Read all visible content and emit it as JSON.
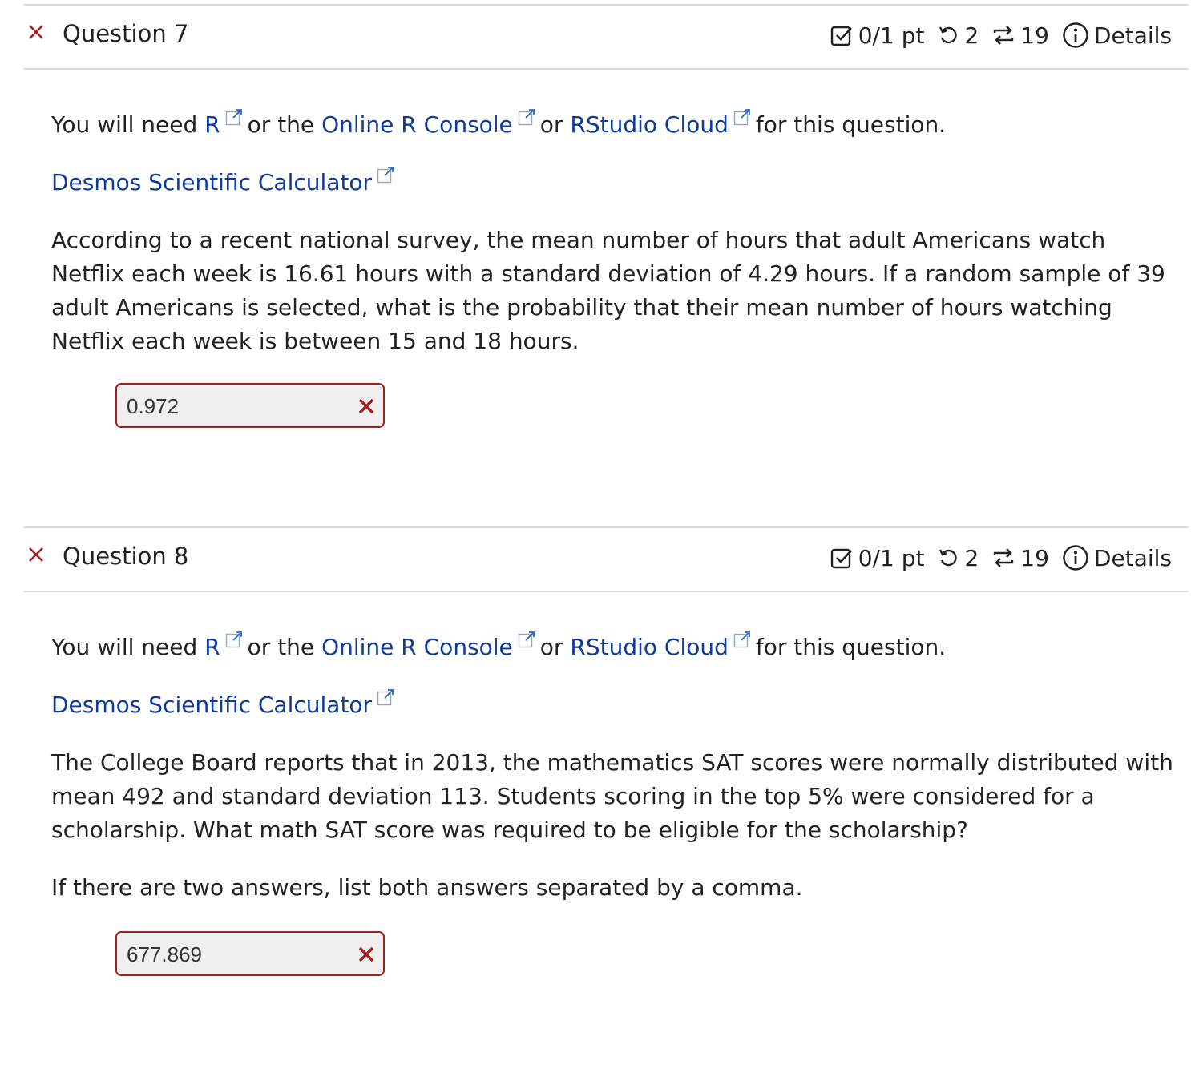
{
  "colors": {
    "link": "#0e3a9a",
    "incorrect": "#a31f1f",
    "answer_bg": "#efefef",
    "divider": "#d9d9d9"
  },
  "questions": [
    {
      "title": "Question 7",
      "status_icon": "close-icon",
      "score": "0/1 pt",
      "attempts": "2",
      "versions": "19",
      "details_label": "Details",
      "tools": {
        "prefix": "You will need",
        "r_link": "R",
        "or_the": "or the",
        "console_link": "Online R Console",
        "or": "or",
        "cloud_link": "RStudio Cloud",
        "suffix": "for this question."
      },
      "desmos_link": "Desmos Scientific Calculator",
      "stem": "According to a recent national survey, the mean number of hours that adult Americans watch Netflix each week is 16.61 hours with a standard deviation of 4.29 hours. If a random sample of 39 adult Americans is selected, what is the probability that their mean number of hours watching Netflix each week is between 15 and 18 hours.",
      "answer": "0.972"
    },
    {
      "title": "Question 8",
      "status_icon": "close-icon",
      "score": "0/1 pt",
      "attempts": "2",
      "versions": "19",
      "details_label": "Details",
      "tools": {
        "prefix": "You will need",
        "r_link": "R",
        "or_the": "or the",
        "console_link": "Online R Console",
        "or": "or",
        "cloud_link": "RStudio Cloud",
        "suffix": "for this question."
      },
      "desmos_link": "Desmos Scientific Calculator",
      "stem": "The College Board reports that in 2013, the mathematics SAT scores were normally distributed with mean 492 and standard deviation 113. Students scoring in the top 5% were considered for a scholarship. What math SAT score was required to be eligible for the scholarship?",
      "note": "If there are two answers, list both answers separated by a comma.",
      "answer": "677.869"
    }
  ]
}
